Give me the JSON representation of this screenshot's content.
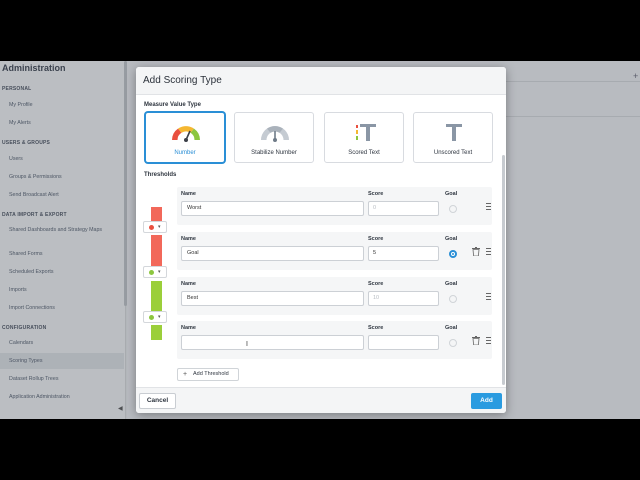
{
  "sidebar": {
    "title": "Administration",
    "sections": [
      {
        "label": "PERSONAL",
        "items": [
          "My Profile",
          "My Alerts"
        ]
      },
      {
        "label": "USERS & GROUPS",
        "items": [
          "Users",
          "Groups & Permissions",
          "Send Broadcast Alert"
        ]
      },
      {
        "label": "DATA IMPORT & EXPORT",
        "items": [
          "Shared Dashboards and Strategy Maps",
          "Shared Forms",
          "Scheduled Exports",
          "Imports",
          "Import Connections"
        ]
      },
      {
        "label": "CONFIGURATION",
        "items": [
          "Calendars",
          "Scoring Types",
          "Dataset Rollup Trees",
          "Application Administration"
        ]
      }
    ],
    "active_item": "Scoring Types"
  },
  "modal": {
    "title": "Add Scoring Type",
    "measure_value_type_label": "Measure Value Type",
    "types": [
      {
        "label": "Number",
        "icon": "gauge-color-icon",
        "selected": true
      },
      {
        "label": "Stabilize Number",
        "icon": "gauge-gray-icon",
        "selected": false
      },
      {
        "label": "Scored Text",
        "icon": "scored-text-icon",
        "selected": false
      },
      {
        "label": "Unscored Text",
        "icon": "unscored-text-icon",
        "selected": false
      }
    ],
    "thresholds_label": "Thresholds",
    "column_labels": {
      "name": "Name",
      "score": "Score",
      "goal": "Goal"
    },
    "thresholds": [
      {
        "name": "Worst",
        "score": "",
        "score_placeholder": "0",
        "goal": false,
        "deletable": false
      },
      {
        "name": "Goal",
        "score": "5",
        "score_placeholder": "",
        "goal": true,
        "deletable": true
      },
      {
        "name": "Best",
        "score": "",
        "score_placeholder": "10",
        "goal": false,
        "deletable": false
      },
      {
        "name": "",
        "score": "",
        "score_placeholder": "",
        "goal": false,
        "deletable": true
      }
    ],
    "band_colors": {
      "red": "#f2685a",
      "green": "#9bcf3a"
    },
    "add_threshold_label": "Add Threshold",
    "cancel_label": "Cancel",
    "add_label": "Add"
  },
  "colors": {
    "accent": "#2a9be0"
  }
}
